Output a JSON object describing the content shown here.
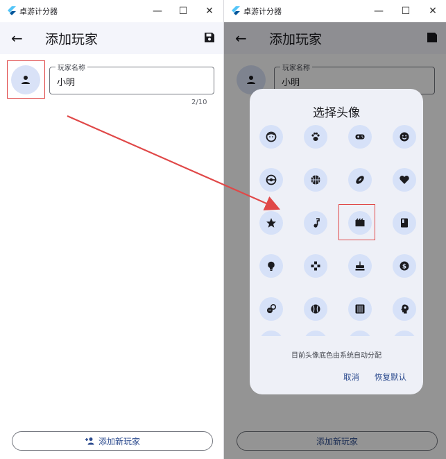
{
  "app": {
    "title": "卓游计分器"
  },
  "left": {
    "appbar_title": "添加玩家",
    "field_label": "玩家名称",
    "field_value": "小明",
    "counter": "2/10",
    "bottom_button": "添加新玩家"
  },
  "right": {
    "bg_appbar_title": "添加玩家",
    "bg_field_label": "玩家名称",
    "bg_field_value": "小明",
    "dialog_title": "选择头像",
    "avatars": [
      "face-icon",
      "paw-icon",
      "gamepad-icon",
      "smiley-icon",
      "pokeball-icon",
      "basketball-icon",
      "football-icon",
      "heart-icon",
      "star-icon",
      "music-note-icon",
      "movie-icon",
      "book-icon",
      "lightbulb-icon",
      "dpad-icon",
      "cake-icon",
      "dollar-icon",
      "mask-icon",
      "baseball-icon",
      "piano-icon",
      "brain-icon",
      "icon-21",
      "icon-22",
      "icon-23",
      "icon-24"
    ],
    "selected_avatar": "movie-icon",
    "note": "目前头像底色由系统自动分配",
    "cancel": "取消",
    "reset": "恢复默认"
  },
  "colors": {
    "accent": "#2b4a8e",
    "avatar_bg": "#d6e1f8",
    "highlight": "#e04848",
    "arrow": "#e04848"
  }
}
